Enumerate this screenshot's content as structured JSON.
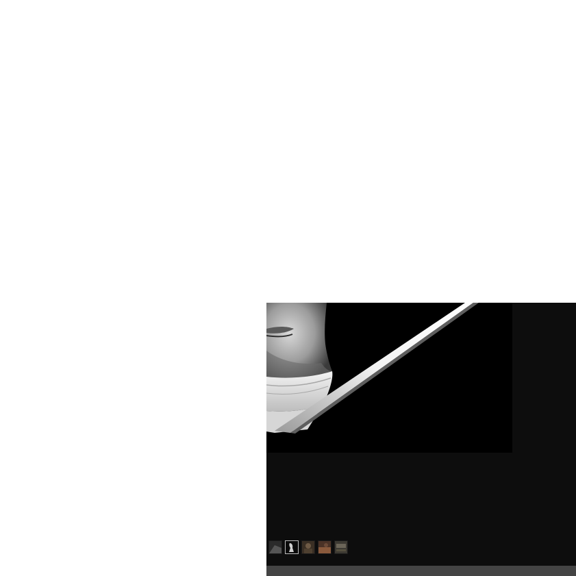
{
  "viewer": {
    "main_image": {
      "subject": "man-book-portrait",
      "palette": [
        "#000000",
        "#f0f0f0",
        "#8a8a8a"
      ]
    },
    "thumbnails": [
      {
        "subject": "thumb-1",
        "colors": [
          "#2b2b2b",
          "#555555"
        ],
        "selected": false
      },
      {
        "subject": "thumb-2",
        "colors": [
          "#0a0a0a",
          "#cfcfcf"
        ],
        "selected": true
      },
      {
        "subject": "thumb-3",
        "colors": [
          "#3a2f24",
          "#6e5a45"
        ],
        "selected": false
      },
      {
        "subject": "thumb-4",
        "colors": [
          "#4a3226",
          "#8a5a3c"
        ],
        "selected": false
      },
      {
        "subject": "thumb-5",
        "colors": [
          "#3d3a33",
          "#6b6558"
        ],
        "selected": false
      }
    ],
    "background_color": "#0d0d0d",
    "bar_color": "#444444"
  }
}
